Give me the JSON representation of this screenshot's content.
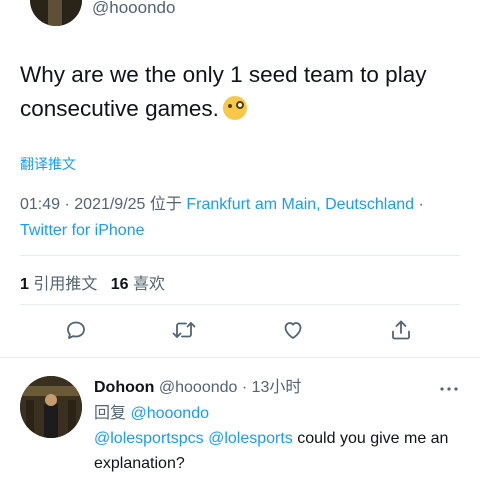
{
  "tweet": {
    "handle": "@hooondo",
    "text": "Why are we the only 1 seed team to play consecutive games.",
    "emoji": "face-with-monocle",
    "translate_label": "翻译推文",
    "time": "01:49",
    "sep1": " · ",
    "date": "2021/9/25",
    "at_label": " 位于 ",
    "location": "Frankfurt am Main, Deutschland",
    "sep2": " · ",
    "client": "Twitter for iPhone"
  },
  "stats": {
    "retweet_count": "1",
    "retweet_label": "引用推文",
    "like_count": "16",
    "like_label": "喜欢"
  },
  "actions": [
    "reply-icon",
    "retweet-icon",
    "like-icon",
    "share-icon"
  ],
  "reply": {
    "name": "Dohoon",
    "handle": "@hooondo",
    "sep": " · ",
    "time": "13小时",
    "replying_label": "回复",
    "replying_to": "@hooondo",
    "mention1": "@lolesportspcs",
    "mention2": "@lolesports",
    "text": "could you give me an explanation?"
  },
  "colors": {
    "accent": "#1d9bf0",
    "secondary_text": "#536471",
    "primary_text": "#0f1419"
  }
}
